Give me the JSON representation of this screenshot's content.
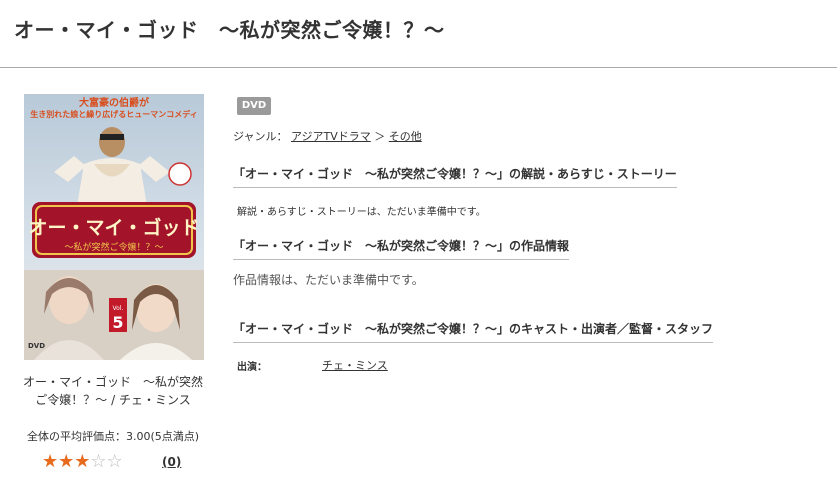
{
  "page": {
    "title": "オー・マイ・ゴッド　～私が突然ご令嬢！？～"
  },
  "product": {
    "cover_alt": "オー・マイ・ゴッド ～私が突然ご令嬢！？～ DVD cover",
    "cover_text": {
      "tagline": "大富豪の伯爵が生き別れた娘と繰り広げるヒューマンコメディ",
      "logo": "オー・マイ・ゴッド",
      "subtitle": "～私が突然ご令嬢！？～",
      "vol": "Vol. 5",
      "dvd": "DVD"
    },
    "name": "オー・マイ・ゴッド　～私が突然ご令嬢！？～ / チェ・ミンス",
    "rating_text": "全体の平均評価点：3.00(5点満点)",
    "rating": 3,
    "rating_max": 5,
    "review_count_open": "(",
    "review_count": "0",
    "review_count_close": ")"
  },
  "detail": {
    "format_badge": "DVD",
    "genre_label": "ジャンル：",
    "genre_primary": "アジアTVドラマ",
    "genre_separator": "＞",
    "genre_secondary": "その他",
    "story_heading": "「オー・マイ・ゴッド　～私が突然ご令嬢！？～」の解説・あらすじ・ストーリー",
    "story_text": "解説・あらすじ・ストーリーは、ただいま準備中です。",
    "info_heading": "「オー・マイ・ゴッド　～私が突然ご令嬢！？～」の作品情報",
    "info_text": "作品情報は、ただいま準備中です。",
    "cast_heading": "「オー・マイ・ゴッド　～私が突然ご令嬢！？～」のキャスト・出演者／監督・スタッフ",
    "cast_label": "出演：",
    "cast_value": "チェ・ミンス"
  },
  "colors": {
    "star_full": "#e76a1d",
    "star_empty": "#bdbdbd",
    "badge": "#9a9a9a"
  },
  "icons": {
    "star_full": "★",
    "star_empty": "☆"
  }
}
